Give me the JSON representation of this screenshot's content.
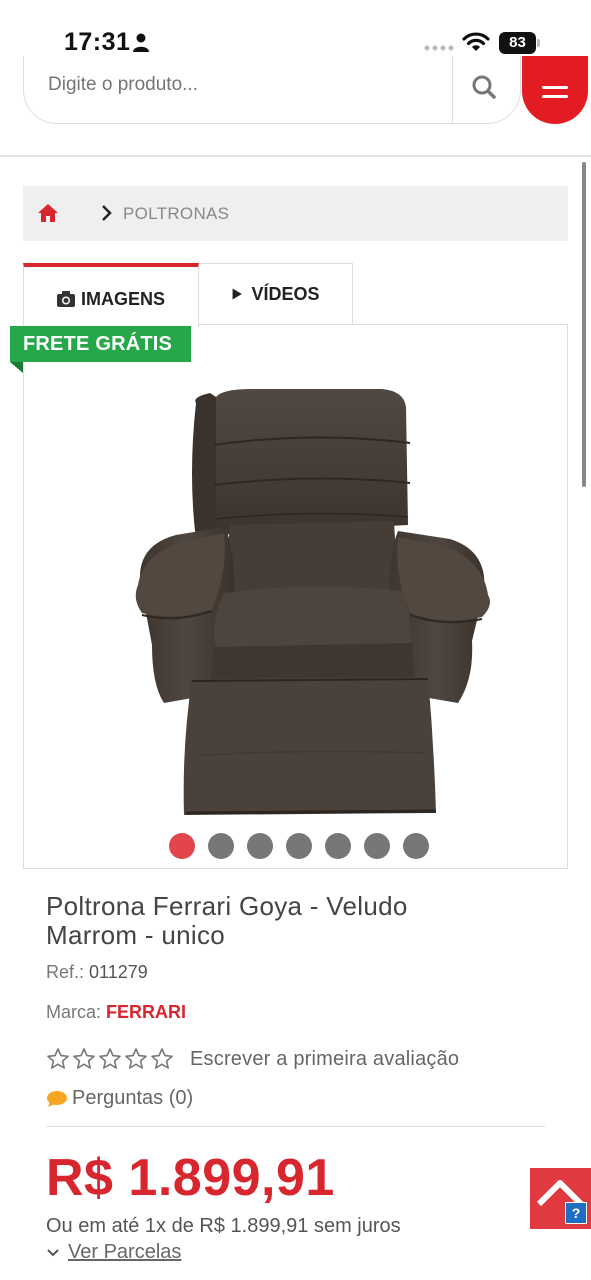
{
  "status_bar": {
    "time": "17:31",
    "battery": "83",
    "icons": [
      "person-icon",
      "signal-dots-icon",
      "wifi-icon",
      "battery-icon"
    ]
  },
  "header": {
    "search_placeholder": "Digite o produto...",
    "search_icon": "search-icon",
    "menu_icon": "hamburger-menu-icon",
    "accent_color": "#e31c24"
  },
  "breadcrumb": {
    "home_icon": "home-icon",
    "separator_icon": "chevron-right-icon",
    "current": "POLTRONAS"
  },
  "tabs": [
    {
      "label": "IMAGENS",
      "icon": "camera-icon",
      "active": true
    },
    {
      "label": "VÍDEOS",
      "icon": "play-icon",
      "active": false
    }
  ],
  "gallery": {
    "badge": "FRETE GRÁTIS",
    "badge_color": "#25a74a",
    "image_alt": "recliner-armchair-image",
    "dot_count": 7,
    "active_dot": 0
  },
  "product": {
    "title": "Poltrona Ferrari Goya - Veludo Marrom - unico",
    "ref_label": "Ref.:",
    "ref_value": "011279",
    "brand_label": "Marca:",
    "brand_value": "FERRARI",
    "rating_stars": 0,
    "rating_max": 5,
    "review_link": "Escrever a primeira avaliação",
    "questions": "Perguntas (0)",
    "price": "R$ 1.899,91",
    "installments": "Ou em até 1x de R$ 1.899,91 sem juros",
    "ver_parcelas": "Ver Parcelas",
    "price_color": "#d8262e"
  },
  "floating": {
    "back_to_top_icon": "chevron-up-icon",
    "help_icon": "question-icon",
    "help_label": "?"
  }
}
